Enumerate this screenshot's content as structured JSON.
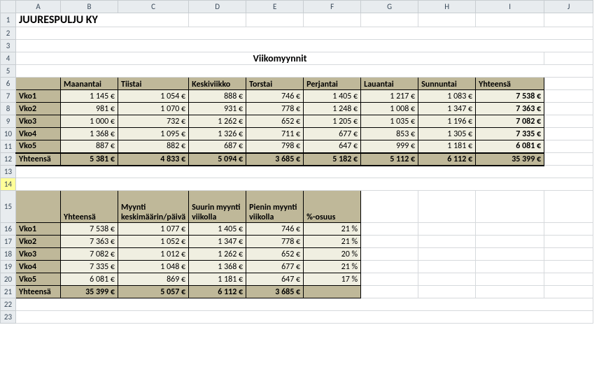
{
  "columns": [
    "",
    "A",
    "B",
    "C",
    "D",
    "E",
    "F",
    "G",
    "H",
    "I",
    "J"
  ],
  "company": "JUURESPULJU KY",
  "subtitle": "Viikomyynnit",
  "table1": {
    "headers": [
      "Maanantai",
      "Tiistai",
      "Keskiviikko",
      "Torstai",
      "Perjantai",
      "Lauantai",
      "Sunnuntai",
      "Yhteensä"
    ],
    "rows": [
      {
        "label": "Vko1",
        "cells": [
          "1 145 €",
          "1 054 €",
          "888 €",
          "746 €",
          "1 405 €",
          "1 217 €",
          "1 083 €",
          "7 538 €"
        ]
      },
      {
        "label": "Vko2",
        "cells": [
          "981 €",
          "1 070 €",
          "931 €",
          "778 €",
          "1 248 €",
          "1 008 €",
          "1 347 €",
          "7 363 €"
        ]
      },
      {
        "label": "Vko3",
        "cells": [
          "1 000 €",
          "732 €",
          "1 262 €",
          "652 €",
          "1 205 €",
          "1 035 €",
          "1 196 €",
          "7 082 €"
        ]
      },
      {
        "label": "Vko4",
        "cells": [
          "1 368 €",
          "1 095 €",
          "1 326 €",
          "711 €",
          "677 €",
          "853 €",
          "1 305 €",
          "7 335 €"
        ]
      },
      {
        "label": "Vko5",
        "cells": [
          "887 €",
          "882 €",
          "687 €",
          "798 €",
          "647 €",
          "999 €",
          "1 181 €",
          "6 081 €"
        ]
      }
    ],
    "totals": {
      "label": "Yhteensä",
      "cells": [
        "5 381 €",
        "4 833 €",
        "5 094 €",
        "3 685 €",
        "5 182 €",
        "5 112 €",
        "6 112 €",
        "35 399 €"
      ]
    }
  },
  "table2": {
    "headers": [
      "Yhteensä",
      "Myynti keskimäärin/päivä",
      "Suurin myynti viikolla",
      "Pienin myynti viikolla",
      "%-osuus"
    ],
    "rows": [
      {
        "label": "Vko1",
        "cells": [
          "7 538 €",
          "1 077 €",
          "1 405 €",
          "746 €",
          "21 %"
        ]
      },
      {
        "label": "Vko2",
        "cells": [
          "7 363 €",
          "1 052 €",
          "1 347 €",
          "778 €",
          "21 %"
        ]
      },
      {
        "label": "Vko3",
        "cells": [
          "7 082 €",
          "1 012 €",
          "1 262 €",
          "652 €",
          "20 %"
        ]
      },
      {
        "label": "Vko4",
        "cells": [
          "7 335 €",
          "1 048 €",
          "1 368 €",
          "677 €",
          "21 %"
        ]
      },
      {
        "label": "Vko5",
        "cells": [
          "6 081 €",
          "869 €",
          "1 181 €",
          "647 €",
          "17 %"
        ]
      }
    ],
    "totals": {
      "label": "Yhteensä",
      "cells": [
        "35 399 €",
        "5 057 €",
        "6 112 €",
        "3 685 €",
        ""
      ]
    }
  },
  "chart_data": [
    {
      "type": "table",
      "title": "Viikomyynnit",
      "categories": [
        "Vko1",
        "Vko2",
        "Vko3",
        "Vko4",
        "Vko5"
      ],
      "series": [
        {
          "name": "Maanantai",
          "values": [
            1145,
            981,
            1000,
            1368,
            887
          ]
        },
        {
          "name": "Tiistai",
          "values": [
            1054,
            1070,
            732,
            1095,
            882
          ]
        },
        {
          "name": "Keskiviikko",
          "values": [
            888,
            931,
            1262,
            1326,
            687
          ]
        },
        {
          "name": "Torstai",
          "values": [
            746,
            778,
            652,
            711,
            798
          ]
        },
        {
          "name": "Perjantai",
          "values": [
            1405,
            1248,
            1205,
            677,
            647
          ]
        },
        {
          "name": "Lauantai",
          "values": [
            1217,
            1008,
            1035,
            853,
            999
          ]
        },
        {
          "name": "Sunnuntai",
          "values": [
            1083,
            1347,
            1196,
            1305,
            1181
          ]
        },
        {
          "name": "Yhteensä",
          "values": [
            7538,
            7363,
            7082,
            7335,
            6081
          ]
        }
      ]
    },
    {
      "type": "table",
      "title": "Summary",
      "categories": [
        "Vko1",
        "Vko2",
        "Vko3",
        "Vko4",
        "Vko5"
      ],
      "series": [
        {
          "name": "Yhteensä",
          "values": [
            7538,
            7363,
            7082,
            7335,
            6081
          ]
        },
        {
          "name": "Myynti keskimäärin/päivä",
          "values": [
            1077,
            1052,
            1012,
            1048,
            869
          ]
        },
        {
          "name": "Suurin myynti viikolla",
          "values": [
            1405,
            1347,
            1262,
            1368,
            1181
          ]
        },
        {
          "name": "Pienin myynti viikolla",
          "values": [
            746,
            778,
            652,
            677,
            647
          ]
        },
        {
          "name": "%-osuus",
          "values": [
            21,
            21,
            20,
            21,
            17
          ]
        }
      ]
    }
  ]
}
